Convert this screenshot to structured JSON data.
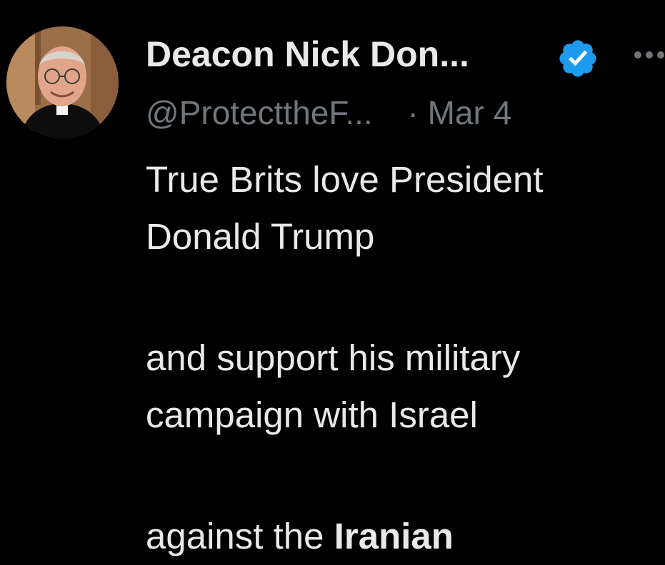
{
  "tweet": {
    "author": {
      "display_name": "Deacon Nick Don...",
      "handle": "@ProtecttheF...",
      "verified_icon": "verified-badge-icon",
      "avatar": "profile-photo"
    },
    "separator": "·",
    "date": "Mar 4",
    "more_icon": "more-options-icon",
    "text": {
      "line1": "True Brits love President",
      "line2": "Donald Trump",
      "line3": "and support his military",
      "line4": "campaign with Israel",
      "line5_prefix": "against the ",
      "line5_bold": "Iranian"
    }
  },
  "colors": {
    "background": "#000000",
    "primary_text": "#e7e9ea",
    "secondary_text": "#71767b",
    "verified_blue": "#1d9bf0"
  }
}
